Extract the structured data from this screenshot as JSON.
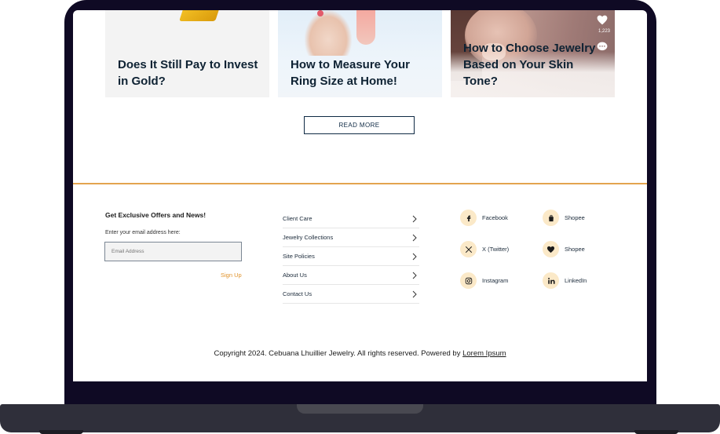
{
  "blog": {
    "cards": [
      {
        "title": "Does It Still Pay to Invest in Gold?"
      },
      {
        "title": "How to Measure Your Ring Size at Home!"
      },
      {
        "title": "How to Choose Jewelry Based on Your Skin Tone?",
        "like_count": "1,223"
      }
    ],
    "read_more_label": "READ MORE"
  },
  "newsletter": {
    "title": "Get Exclusive Offers and News!",
    "subtitle": "Enter your email address here:",
    "email_placeholder": "Email Address",
    "signup_label": "Sign Up"
  },
  "footer_links": [
    {
      "label": "Client Care"
    },
    {
      "label": "Jewelry Collections"
    },
    {
      "label": "Site Policies"
    },
    {
      "label": "About Us"
    },
    {
      "label": "Contact Us"
    }
  ],
  "social": [
    {
      "label": "Facebook",
      "icon": "facebook-icon"
    },
    {
      "label": "Shopee",
      "icon": "shopping-bag-icon"
    },
    {
      "label": "X (Twitter)",
      "icon": "x-twitter-icon"
    },
    {
      "label": "Shopee",
      "icon": "heart-bag-icon"
    },
    {
      "label": "Instagram",
      "icon": "instagram-icon"
    },
    {
      "label": "LinkedIn",
      "icon": "linkedin-icon"
    }
  ],
  "copyright": {
    "text": "Copyright 2024. Cebuana Lhuillier Jewelry. All rights reserved. Powered by ",
    "link_text": "Lorem Ipsum"
  },
  "colors": {
    "accent_orange": "#e3a44f",
    "signup_orange": "#e0932c",
    "navy": "#0f2a44",
    "icon_circle": "#fbe9c8",
    "bezel": "#0f0a24"
  }
}
